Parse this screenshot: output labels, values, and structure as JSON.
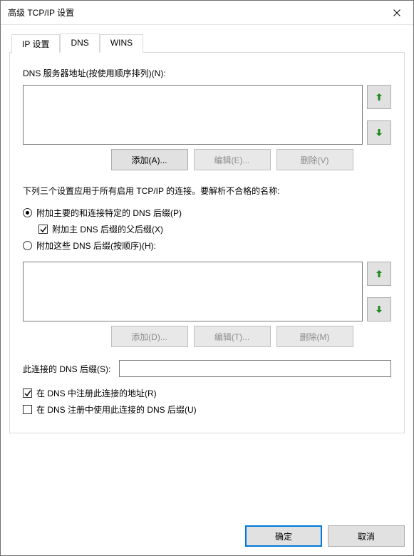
{
  "window": {
    "title": "高级 TCP/IP 设置"
  },
  "tabs": {
    "ip": "IP 设置",
    "dns": "DNS",
    "wins": "WINS",
    "active": "dns"
  },
  "dns": {
    "servers_label": "DNS 服务器地址(按使用顺序排列)(N):",
    "servers_items": [],
    "servers_buttons": {
      "add": "添加(A)...",
      "edit": "编辑(E)...",
      "remove": "删除(V)"
    },
    "desc": "下列三个设置应用于所有启用 TCP/IP 的连接。要解析不合格的名称:",
    "radio_primary": {
      "label": "附加主要的和连接特定的 DNS 后缀(P)",
      "selected": true
    },
    "check_parent": {
      "label": "附加主 DNS 后缀的父后缀(X)",
      "checked": true
    },
    "radio_these": {
      "label": "附加这些 DNS 后缀(按顺序)(H):",
      "selected": false
    },
    "suffix_items": [],
    "suffix_buttons": {
      "add": "添加(D)...",
      "edit": "编辑(T)...",
      "remove": "删除(M)"
    },
    "conn_suffix_label": "此连接的 DNS 后缀(S):",
    "conn_suffix_value": "",
    "check_register": {
      "label": "在 DNS 中注册此连接的地址(R)",
      "checked": true
    },
    "check_use_suffix": {
      "label": "在 DNS 注册中使用此连接的 DNS 后缀(U)",
      "checked": false
    }
  },
  "footer": {
    "ok": "确定",
    "cancel": "取消"
  },
  "colors": {
    "accent": "#0078d7",
    "arrow": "#1e8a1e"
  }
}
